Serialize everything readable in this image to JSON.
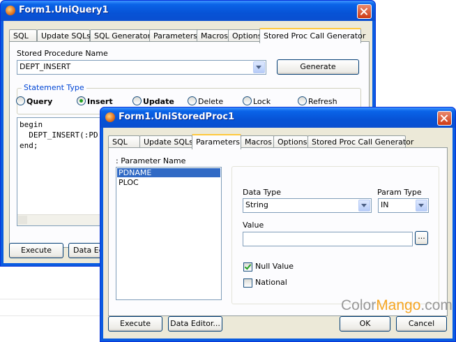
{
  "win1": {
    "title": "Form1.UniQuery1",
    "tabs": [
      "SQL",
      "Update SQLs",
      "SQL Generator",
      "Parameters",
      "Macros",
      "Options",
      "Stored Proc Call Generator"
    ],
    "sp_name_label": "Stored Procedure Name",
    "sp_name_value": "DEPT_INSERT",
    "generate_label": "Generate",
    "stmt_type_label": "Statement Type",
    "statement_types": [
      "Query",
      "Insert",
      "Update",
      "Delete",
      "Lock",
      "Refresh"
    ],
    "selected_statement_type": "Insert",
    "memo_lines": [
      "begin",
      "  DEPT_INSERT(:PD",
      "end;"
    ],
    "execute_label": "Execute",
    "data_editor_label": "Data Edi"
  },
  "win2": {
    "title": "Form1.UniStoredProc1",
    "tabs": [
      "SQL",
      "Update SQLs",
      "Parameters",
      "Macros",
      "Options",
      "Stored Proc Call Generator"
    ],
    "param_header": ": Parameter Name",
    "params": [
      "PDNAME",
      "PLOC"
    ],
    "selected_param": "PDNAME",
    "data_type_label": "Data Type",
    "data_type_value": "String",
    "param_type_label": "Param Type",
    "param_type_value": "IN",
    "value_label": "Value",
    "value_value": "",
    "browse_label": "...",
    "null_value_label": "Null Value",
    "null_value_checked": true,
    "national_label": "National",
    "national_checked": false,
    "execute_label": "Execute",
    "data_editor_label": "Data Editor...",
    "ok_label": "OK",
    "cancel_label": "Cancel"
  },
  "watermark": {
    "part1": "Color",
    "part2": "Mango",
    "part3": ".com"
  }
}
